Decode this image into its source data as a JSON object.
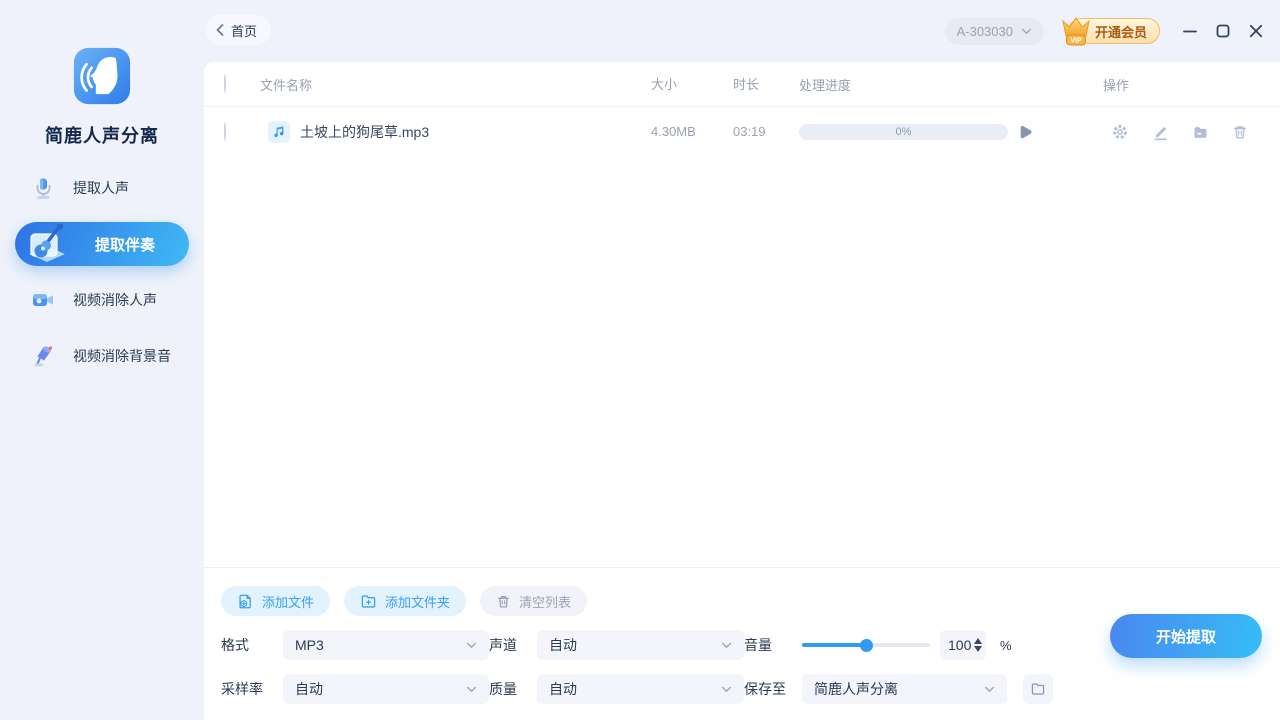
{
  "topbar": {
    "back_label": "首页",
    "account_id": "A-303030",
    "vip_badge": "VIP",
    "vip_label": "开通会员"
  },
  "sidebar": {
    "app_name": "简鹿人声分离",
    "items": [
      {
        "label": "提取人声",
        "icon": "mic-icon",
        "active": false
      },
      {
        "label": "提取伴奏",
        "icon": "guitar-icon",
        "active": true
      },
      {
        "label": "视频消除人声",
        "icon": "video-icon",
        "active": false
      },
      {
        "label": "视频消除背景音",
        "icon": "speaker-icon",
        "active": false
      }
    ]
  },
  "table": {
    "headers": {
      "name": "文件名称",
      "size": "大小",
      "duration": "时长",
      "progress": "处理进度",
      "actions": "操作"
    },
    "rows": [
      {
        "name": "土坡上的狗尾草.mp3",
        "size": "4.30MB",
        "duration": "03:19",
        "progress": "0%"
      }
    ]
  },
  "footer": {
    "buttons": {
      "add_file": "添加文件",
      "add_folder": "添加文件夹",
      "clear_list": "清空列表"
    },
    "settings": {
      "format_label": "格式",
      "format_value": "MP3",
      "channel_label": "声道",
      "channel_value": "自动",
      "volume_label": "音量",
      "volume_value": "100",
      "volume_unit": "%",
      "sample_rate_label": "采样率",
      "sample_rate_value": "自动",
      "quality_label": "质量",
      "quality_value": "自动",
      "save_to_label": "保存至",
      "save_to_value": "简鹿人声分离"
    },
    "start_button": "开始提取"
  },
  "colors": {
    "accent_blue": "#2f9bf2",
    "active_gradient_start": "#2f72e4",
    "active_gradient_end": "#3fb9f6",
    "start_gradient_start": "#4b87ef",
    "start_gradient_end": "#35bdf8",
    "vip_border": "#f3bd62",
    "vip_text": "#a85c16",
    "muted_text": "#99a1b3",
    "icon_gray": "#b3bed6",
    "window_bg": "#eff2fa",
    "card_bg": "#ffffff"
  }
}
